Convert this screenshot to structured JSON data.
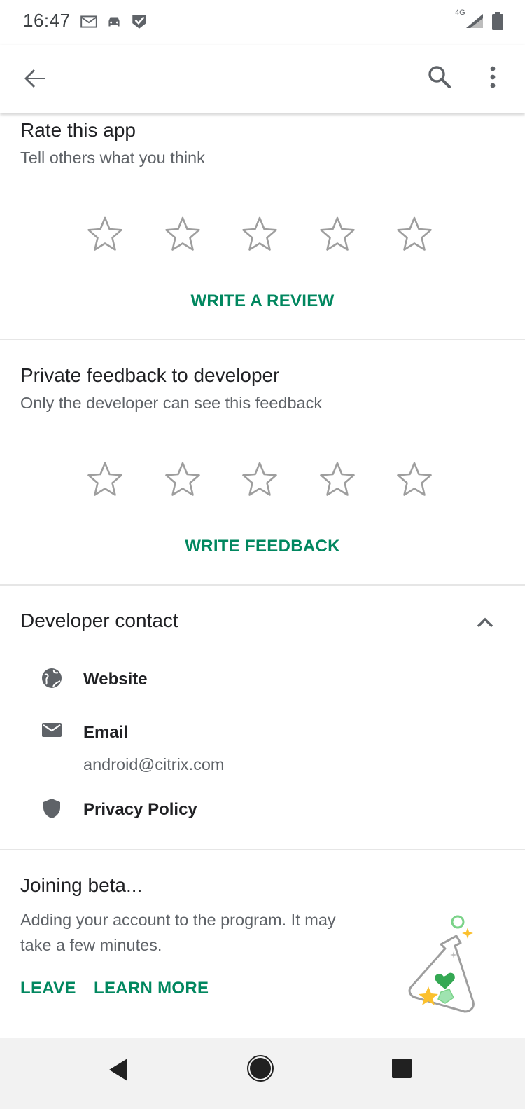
{
  "status_bar": {
    "time": "16:47",
    "left_icons": [
      "mail-icon",
      "car-icon",
      "checkmark-badge-icon"
    ],
    "right_icons": [
      "4g-signal-icon",
      "signal-icon",
      "battery-icon"
    ],
    "network_label": "4G"
  },
  "toolbar": {
    "back_icon": "arrow-back-icon",
    "search_icon": "search-icon",
    "more_icon": "more-vert-icon"
  },
  "rate": {
    "title": "Rate this app",
    "subtitle": "Tell others what you think",
    "stars_filled": 0,
    "stars_total": 5,
    "button": "WRITE A REVIEW"
  },
  "feedback": {
    "title": "Private feedback to developer",
    "subtitle": "Only the developer can see this feedback",
    "stars_filled": 0,
    "stars_total": 5,
    "button": "WRITE FEEDBACK"
  },
  "contact": {
    "title": "Developer contact",
    "website_label": "Website",
    "email_label": "Email",
    "email_value": "android@citrix.com",
    "privacy_label": "Privacy Policy"
  },
  "beta": {
    "title": "Joining beta...",
    "line1": "Adding your account to the program. It may",
    "line2": "take a few minutes.",
    "leave": "LEAVE",
    "learn_more": "LEARN MORE"
  },
  "colors": {
    "accent": "#01875f",
    "star_outline": "#9e9e9e",
    "text_primary": "#202124",
    "text_secondary": "#5f6368"
  }
}
